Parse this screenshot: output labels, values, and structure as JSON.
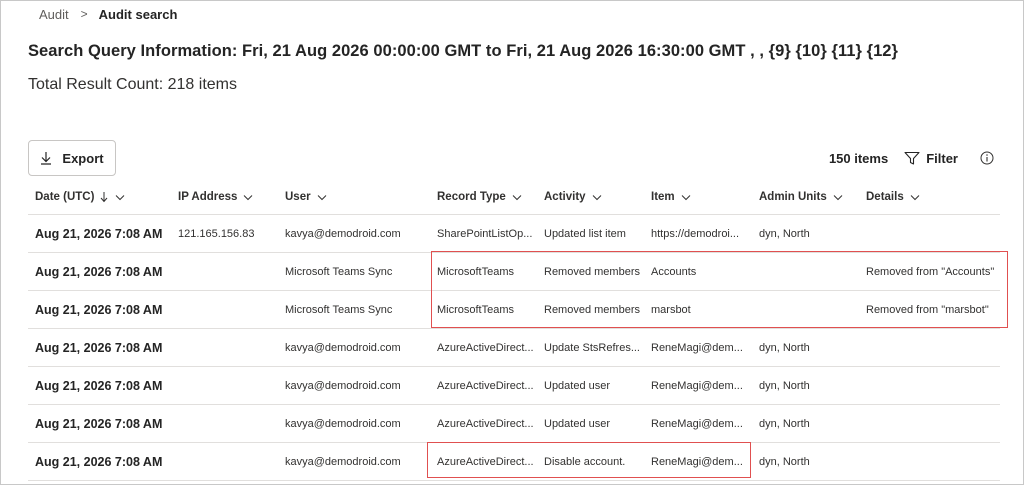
{
  "breadcrumb": {
    "parent": "Audit",
    "separator": ">",
    "current": "Audit search"
  },
  "query_title": "Search Query Information: Fri, 21 Aug 2026 00:00:00 GMT to Fri, 21 Aug 2026 16:30:00 GMT , , {9} {10} {11} {12}",
  "result_count": "Total Result Count: 218 items",
  "toolbar": {
    "export_label": "Export",
    "item_count": "150 items",
    "filter_label": "Filter"
  },
  "icons": [
    "download-icon",
    "filter-icon",
    "info-icon",
    "sort-down-icon",
    "chevron-down-icon"
  ],
  "colors": {
    "highlight": "#e05050",
    "border": "#e1dfdd"
  },
  "columns": [
    {
      "label": "Date (UTC)"
    },
    {
      "label": "IP Address"
    },
    {
      "label": "User"
    },
    {
      "label": "Record Type"
    },
    {
      "label": "Activity"
    },
    {
      "label": "Item"
    },
    {
      "label": "Admin Units"
    },
    {
      "label": "Details"
    }
  ],
  "rows": [
    {
      "date": "Aug 21, 2026 7:08 AM",
      "ip": "121.165.156.83",
      "user": "kavya@demodroid.com",
      "record_type": "SharePointListOp...",
      "activity": "Updated list item",
      "item": "https://demodroi...",
      "admin_units": "dyn, North",
      "details": ""
    },
    {
      "date": "Aug 21, 2026 7:08 AM",
      "ip": "",
      "user": "Microsoft Teams Sync",
      "record_type": "MicrosoftTeams",
      "activity": "Removed members",
      "item": "Accounts",
      "admin_units": "",
      "details": "Removed from \"Accounts\""
    },
    {
      "date": "Aug 21, 2026 7:08 AM",
      "ip": "",
      "user": "Microsoft Teams Sync",
      "record_type": "MicrosoftTeams",
      "activity": "Removed members",
      "item": "marsbot",
      "admin_units": "",
      "details": "Removed from \"marsbot\""
    },
    {
      "date": "Aug 21, 2026 7:08 AM",
      "ip": "",
      "user": "kavya@demodroid.com",
      "record_type": "AzureActiveDirect...",
      "activity": "Update StsRefres...",
      "item": "ReneMagi@dem...",
      "admin_units": "dyn, North",
      "details": ""
    },
    {
      "date": "Aug 21, 2026 7:08 AM",
      "ip": "",
      "user": "kavya@demodroid.com",
      "record_type": "AzureActiveDirect...",
      "activity": "Updated user",
      "item": "ReneMagi@dem...",
      "admin_units": "dyn, North",
      "details": ""
    },
    {
      "date": "Aug 21, 2026 7:08 AM",
      "ip": "",
      "user": "kavya@demodroid.com",
      "record_type": "AzureActiveDirect...",
      "activity": "Updated user",
      "item": "ReneMagi@dem...",
      "admin_units": "dyn, North",
      "details": ""
    },
    {
      "date": "Aug 21, 2026 7:08 AM",
      "ip": "",
      "user": "kavya@demodroid.com",
      "record_type": "AzureActiveDirect...",
      "activity": "Disable account.",
      "item": "ReneMagi@dem...",
      "admin_units": "dyn, North",
      "details": ""
    }
  ]
}
